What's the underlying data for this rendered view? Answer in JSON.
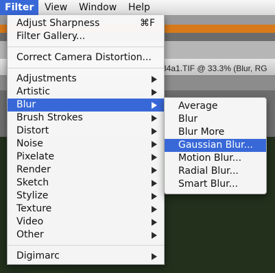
{
  "menubar": {
    "items": [
      "Filter",
      "View",
      "Window",
      "Help"
    ],
    "active_index": 0
  },
  "document": {
    "title_fragment": "34a1.TIF @ 33.3% (Blur, RG"
  },
  "filter_menu": {
    "adjust_sharpness": {
      "label": "Adjust Sharpness",
      "shortcut": "⌘F"
    },
    "filter_gallery": "Filter Gallery...",
    "correct_camera": "Correct Camera Distortion...",
    "submenus": [
      "Adjustments",
      "Artistic",
      "Blur",
      "Brush Strokes",
      "Distort",
      "Noise",
      "Pixelate",
      "Render",
      "Sketch",
      "Stylize",
      "Texture",
      "Video",
      "Other"
    ],
    "highlighted": "Blur",
    "digimarc": "Digimarc"
  },
  "blur_menu": {
    "items": [
      "Average",
      "Blur",
      "Blur More",
      "Gaussian Blur...",
      "Motion Blur...",
      "Radial Blur...",
      "Smart Blur..."
    ],
    "highlighted": "Gaussian Blur..."
  },
  "colors": {
    "highlight": "#3868d8",
    "menu_bg": "#f8f8f8"
  }
}
